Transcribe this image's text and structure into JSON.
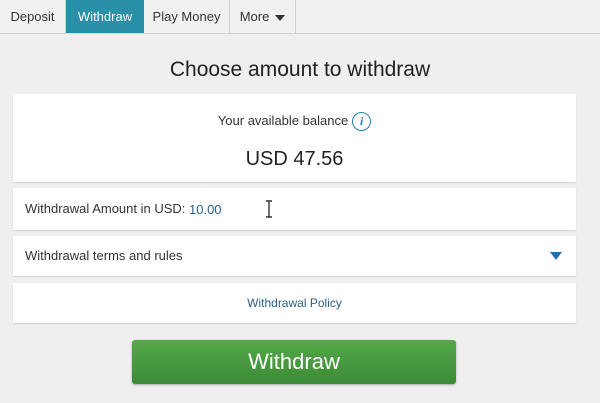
{
  "tabs": [
    {
      "label": "Deposit",
      "active": false
    },
    {
      "label": "Withdraw",
      "active": true
    },
    {
      "label": "Play Money",
      "active": false
    },
    {
      "label": "More",
      "active": false
    }
  ],
  "heading": "Choose amount to withdraw",
  "balance": {
    "label": "Your available balance",
    "value": "USD 47.56",
    "info_icon": "info-icon"
  },
  "amount": {
    "label": "Withdrawal Amount in USD:",
    "value": "10.00"
  },
  "terms": {
    "label": "Withdrawal terms and rules"
  },
  "policy": {
    "link": "Withdrawal Policy"
  },
  "withdraw_button": "Withdraw",
  "colors": {
    "tab_active": "#2a8fa8",
    "button_green": "#4a9c3f",
    "link_blue": "#2a5f8a"
  }
}
